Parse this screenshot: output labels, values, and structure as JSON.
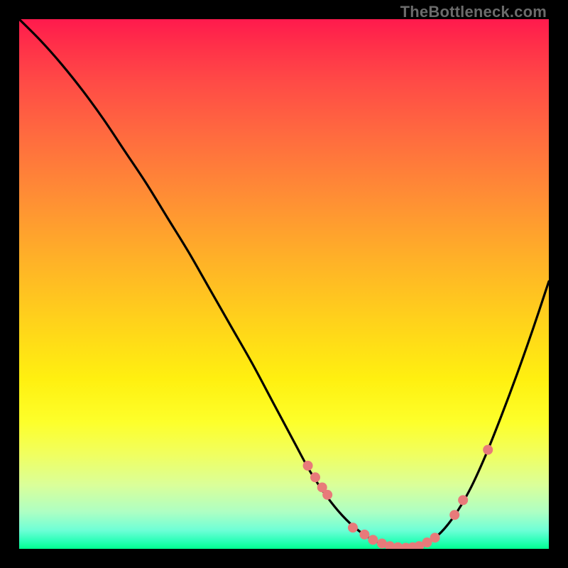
{
  "watermark": "TheBottleneck.com",
  "colors": {
    "background": "#000000",
    "curve": "#000000",
    "marker": "#e87a7a",
    "text": "#6b6b6b"
  },
  "chart_data": {
    "type": "line",
    "title": "",
    "xlabel": "",
    "ylabel": "",
    "xlim": [
      0,
      100
    ],
    "ylim": [
      0,
      100
    ],
    "grid": false,
    "series": [
      {
        "name": "bottleneck-curve",
        "x": [
          0,
          4,
          8,
          12,
          16,
          20,
          24,
          28,
          32,
          36,
          40,
          44,
          48,
          52,
          55,
          58,
          61,
          64,
          67,
          70,
          73,
          76,
          79,
          82,
          85,
          88,
          91,
          94,
          97,
          100
        ],
        "y": [
          100,
          96,
          91.5,
          86.5,
          81,
          75,
          69,
          62.5,
          56,
          49,
          42,
          35,
          27.5,
          20,
          14.5,
          10,
          6.3,
          3.5,
          1.6,
          0.5,
          0.2,
          0.7,
          2.5,
          6,
          11,
          17.5,
          25,
          33,
          41.5,
          50.5
        ]
      }
    ],
    "markers": {
      "name": "highlighted-points",
      "x": [
        54.5,
        55.9,
        57.2,
        58.2,
        63.0,
        65.2,
        66.8,
        68.5,
        70.0,
        71.5,
        73.0,
        74.3,
        75.5,
        77.0,
        78.5,
        82.2,
        83.8,
        88.5
      ],
      "y": [
        15.7,
        13.5,
        11.6,
        10.2,
        4.0,
        2.7,
        1.7,
        1.0,
        0.5,
        0.3,
        0.2,
        0.3,
        0.5,
        1.2,
        2.1,
        6.4,
        9.2,
        18.7
      ]
    }
  }
}
